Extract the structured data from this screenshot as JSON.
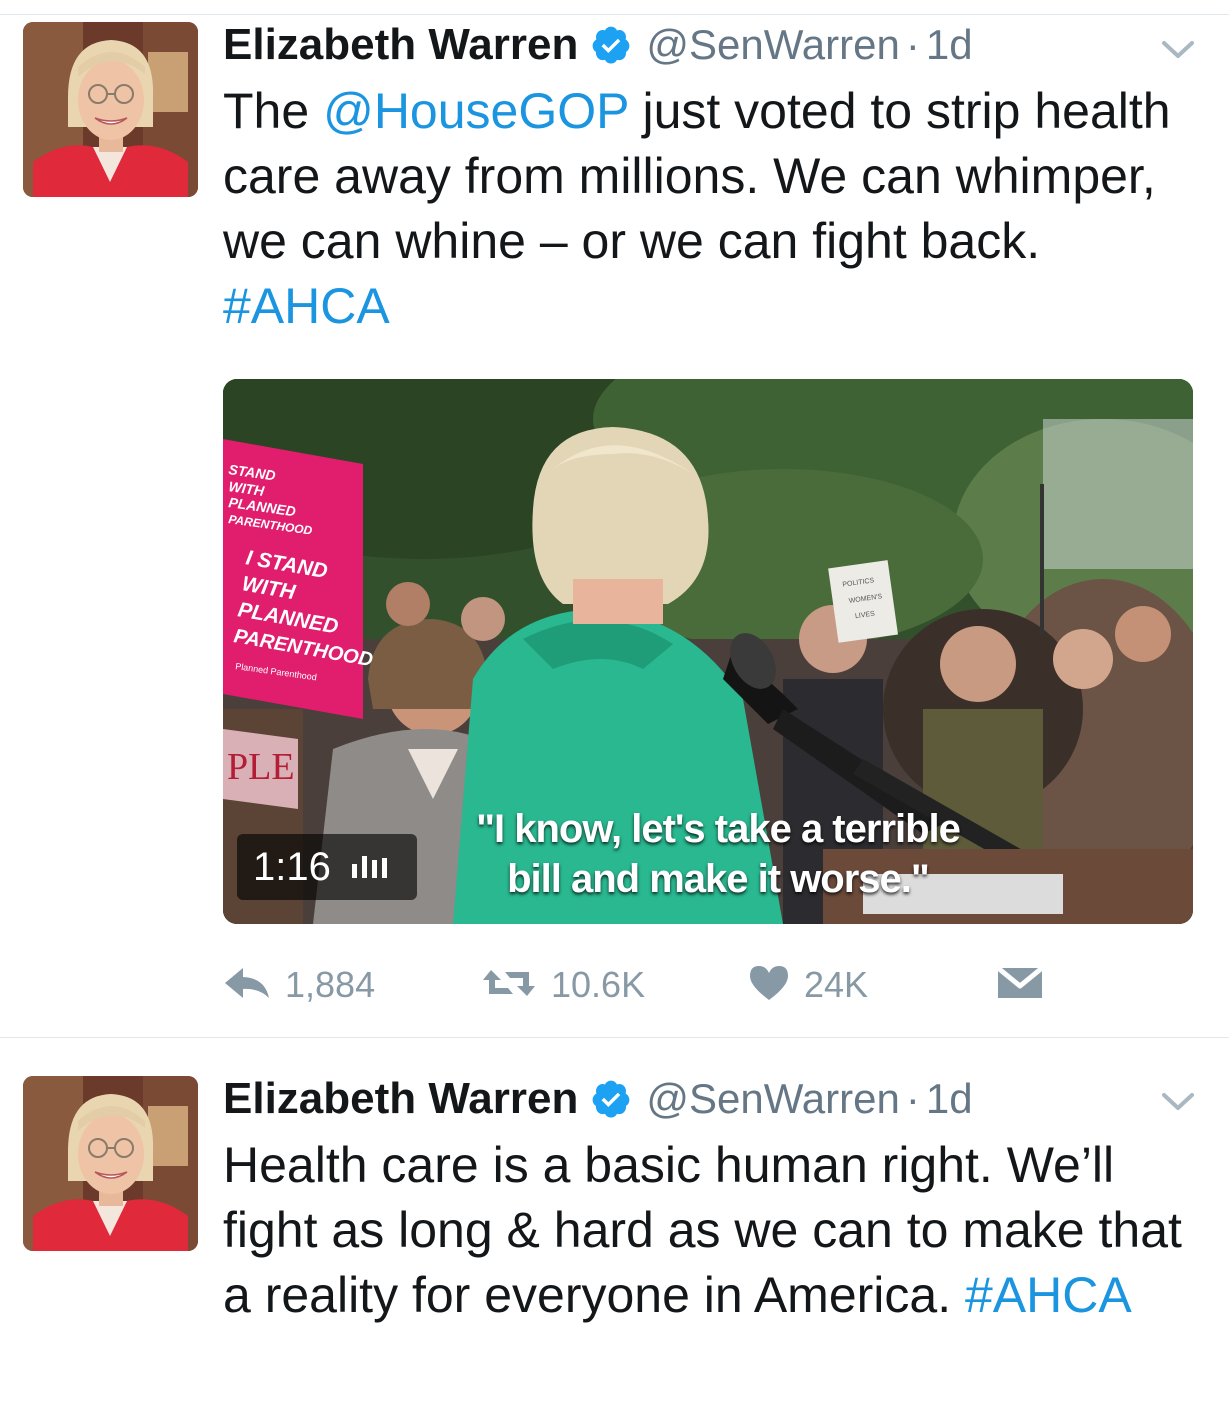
{
  "tweets": [
    {
      "author": {
        "name": "Elizabeth Warren",
        "handle": "@SenWarren",
        "time": "1d"
      },
      "text": {
        "prefix": "The ",
        "mention": "@HouseGOP",
        "body": " just voted to strip health care away from millions. We can whimper, we can whine – or we can fight back. ",
        "hashtag": "#AHCA"
      },
      "media": {
        "type": "video",
        "duration": "1:16",
        "caption": "\"I know, let's take a terrible bill and make it worse.\"",
        "signs": {
          "top": [
            "STAND",
            "WITH",
            "PLANNED",
            "PARENTHOOD"
          ],
          "main": [
            "I STAND",
            "WITH",
            "PLANNED",
            "PARENTHOOD"
          ],
          "org": "Planned Parenthood",
          "right": [
            "POLITICS",
            "WOMEN'S",
            "LIVES"
          ],
          "partial": "PLE"
        }
      },
      "actions": {
        "replies": "1,884",
        "retweets": "10.6K",
        "likes": "24K"
      }
    },
    {
      "author": {
        "name": "Elizabeth Warren",
        "handle": "@SenWarren",
        "time": "1d"
      },
      "text": {
        "body": "Health care is a basic human right. We’ll fight as long & hard as we can to make that a reality for everyone in America. ",
        "hashtag": "#AHCA"
      }
    }
  ],
  "colors": {
    "link": "#1b95e0",
    "verified": "#1da1f2",
    "muted": "#657786",
    "action": "#8899a6",
    "divider": "#e1e8ed"
  },
  "icons": [
    "verified-badge-icon",
    "chevron-down-icon",
    "reply-icon",
    "retweet-icon",
    "like-icon",
    "direct-message-icon",
    "audio-equalizer-icon"
  ]
}
